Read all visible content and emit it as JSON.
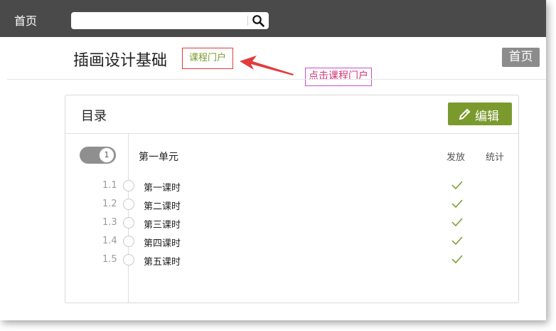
{
  "topbar": {
    "home_label": "首页",
    "search_value": ""
  },
  "header": {
    "course_title": "插画设计基础",
    "portal_button": "课程门户",
    "annotation": "点击课程门户",
    "home_badge": "首页"
  },
  "catalog": {
    "title": "目录",
    "edit_button": "编辑",
    "unit": {
      "toggle_number": "1",
      "name": "第一单元"
    },
    "columns": {
      "publish": "发放",
      "stats": "统计"
    },
    "lessons": [
      {
        "num": "1.1",
        "name": "第一课时",
        "published": true
      },
      {
        "num": "1.2",
        "name": "第二课时",
        "published": true
      },
      {
        "num": "1.3",
        "name": "第三课时",
        "published": true
      },
      {
        "num": "1.4",
        "name": "第四课时",
        "published": true
      },
      {
        "num": "1.5",
        "name": "第五课时",
        "published": true
      }
    ]
  },
  "colors": {
    "topbar_bg": "#4a4a4a",
    "accent_green": "#7a9a2e",
    "annotation_red": "#e23b3b",
    "annotation_border": "#c84fd0"
  },
  "icons": {
    "search": "search-icon",
    "edit": "pencil-icon",
    "published": "check-icon"
  }
}
